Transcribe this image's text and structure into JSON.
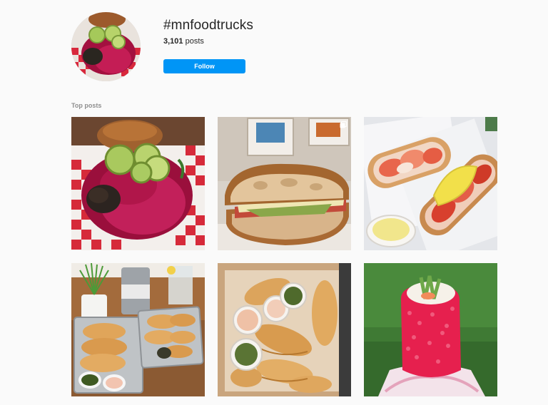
{
  "header": {
    "hashtag": "#mnfoodtrucks",
    "post_count": "3,101",
    "posts_label": "posts",
    "follow_label": "Follow"
  },
  "sections": {
    "top_posts_label": "Top posts"
  },
  "posts": [
    {
      "subject": "beet-slaw-sandwich"
    },
    {
      "subject": "ciabatta-sandwich",
      "multi": true
    },
    {
      "subject": "lobster-rolls"
    },
    {
      "subject": "empanadas-tray"
    },
    {
      "subject": "empanadas-box"
    },
    {
      "subject": "sushi-burrito"
    }
  ],
  "colors": {
    "accent": "#0095f6",
    "background": "#fafafa"
  }
}
